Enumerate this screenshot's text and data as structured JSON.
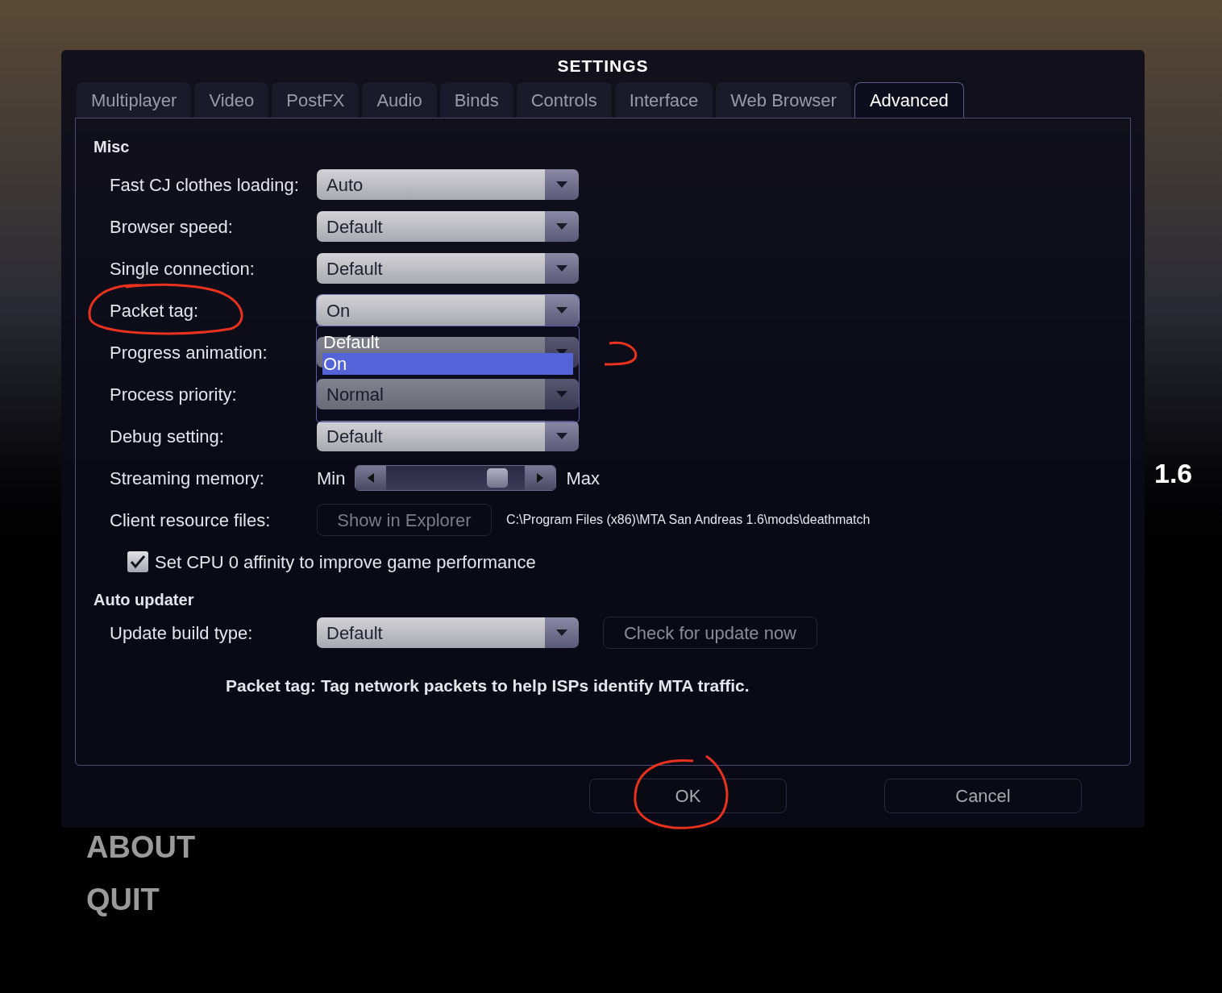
{
  "background": {
    "version": "1.6",
    "menu": [
      "ABOUT",
      "QUIT"
    ]
  },
  "window": {
    "title": "SETTINGS"
  },
  "tabs": [
    {
      "label": "Multiplayer",
      "selected": false
    },
    {
      "label": "Video",
      "selected": false
    },
    {
      "label": "PostFX",
      "selected": false
    },
    {
      "label": "Audio",
      "selected": false
    },
    {
      "label": "Binds",
      "selected": false
    },
    {
      "label": "Controls",
      "selected": false
    },
    {
      "label": "Interface",
      "selected": false
    },
    {
      "label": "Web Browser",
      "selected": false
    },
    {
      "label": "Advanced",
      "selected": true
    }
  ],
  "misc": {
    "heading": "Misc",
    "rows": [
      {
        "kind": "select",
        "label": "Fast CJ clothes loading:",
        "value": "Auto"
      },
      {
        "kind": "select",
        "label": "Browser speed:",
        "value": "Default"
      },
      {
        "kind": "select",
        "label": "Single connection:",
        "value": "Default"
      },
      {
        "kind": "select",
        "label": "Packet tag:",
        "value": "On",
        "expanded": true,
        "options": [
          {
            "label": "Default",
            "selected": false
          },
          {
            "label": "On",
            "selected": true
          }
        ]
      },
      {
        "kind": "select",
        "label": "Progress animation:"
      },
      {
        "kind": "select",
        "label": "Process priority:",
        "value": "Normal"
      },
      {
        "kind": "select",
        "label": "Debug setting:",
        "value": "Default"
      },
      {
        "kind": "slider",
        "label": "Streaming memory:",
        "min_label": "Min",
        "max_label": "Max",
        "level": 0.85
      },
      {
        "kind": "path",
        "label": "Client resource files:",
        "button": "Show in Explorer",
        "path": "C:\\Program Files (x86)\\MTA San Andreas 1.6\\mods\\deathmatch"
      },
      {
        "kind": "checkbox",
        "label": "Set CPU 0 affinity to improve game performance",
        "checked": true
      }
    ]
  },
  "auto_updater": {
    "heading": "Auto updater",
    "label": "Update build type:",
    "value": "Default",
    "button": "Check for update now"
  },
  "description": "Packet tag: Tag network packets to help ISPs identify MTA traffic.",
  "buttons": [
    "OK",
    "Cancel"
  ]
}
